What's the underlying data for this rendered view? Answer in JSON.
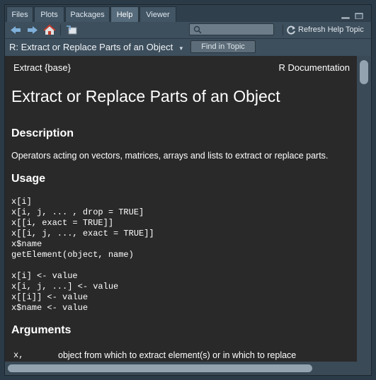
{
  "tabs": [
    {
      "label": "Files",
      "active": false
    },
    {
      "label": "Plots",
      "active": false
    },
    {
      "label": "Packages",
      "active": false
    },
    {
      "label": "Help",
      "active": true
    },
    {
      "label": "Viewer",
      "active": false
    }
  ],
  "toolbar": {
    "back_icon": "arrow-left-icon",
    "forward_icon": "arrow-right-icon",
    "home_icon": "home-icon",
    "popout_icon": "popout-icon",
    "search_placeholder": "",
    "search_icon": "search-icon",
    "refresh_label": "Refresh Help Topic",
    "refresh_icon": "refresh-icon"
  },
  "topic_bar": {
    "topic_label": "R: Extract or Replace Parts of an Object",
    "dropdown_icon": "chevron-down-icon",
    "find_label": "Find in Topic"
  },
  "doc": {
    "header_left": "Extract {base}",
    "header_right": "R Documentation",
    "title": "Extract or Replace Parts of an Object",
    "description_heading": "Description",
    "description_text": "Operators acting on vectors, matrices, arrays and lists to extract or replace parts.",
    "usage_heading": "Usage",
    "usage_block1": "x[i]\nx[i, j, ... , drop = TRUE]\nx[[i, exact = TRUE]]\nx[[i, j, ..., exact = TRUE]]\nx$name\ngetElement(object, name)",
    "usage_block2": "x[i] <- value\nx[i, j, ...] <- value\nx[[i]] <- value\nx$name <- value",
    "arguments_heading": "Arguments",
    "arg1_name": "x,\nobject",
    "arg1_desc": "object from which to extract element(s) or in which to replace element(s)."
  },
  "colors": {
    "doc_background": "#2a2929",
    "pane_background": "#3d4e5c",
    "tab_active": "#566b7b"
  }
}
